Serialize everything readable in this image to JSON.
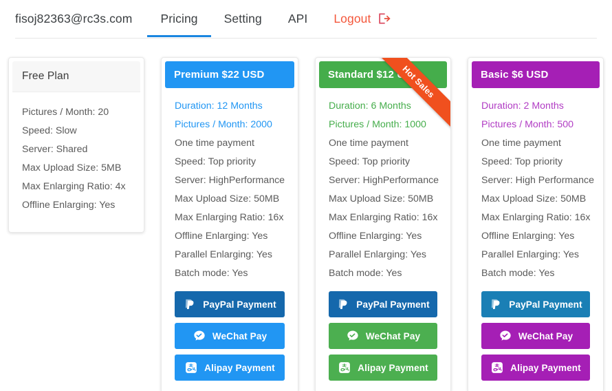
{
  "nav": {
    "brand": "fisoj82363@rc3s.com",
    "items": [
      {
        "label": "Pricing",
        "active": true
      },
      {
        "label": "Setting",
        "active": false
      },
      {
        "label": "API",
        "active": false
      }
    ],
    "logout": {
      "label": "Logout",
      "icon": "sign-out-icon",
      "color": "#f4573b"
    },
    "active_indicator_color": "#1a86e0"
  },
  "ribbon": {
    "text": "Hot Sales",
    "color": "#f0501e"
  },
  "plans": [
    {
      "id": "free",
      "title": "Free Plan",
      "accent": "#f7f7f7",
      "text_color": "#3b3b3b",
      "highlight_color": "#5a5a5a",
      "features": [
        "Pictures / Month: 20",
        "Speed: Slow",
        "Server: Shared",
        "Max Upload Size: 5MB",
        "Max Enlarging Ratio: 4x",
        "Offline Enlarging: Yes"
      ],
      "highlight_count": 0,
      "buttons": []
    },
    {
      "id": "premium",
      "title": "Premium $22 USD",
      "accent": "#2196f3",
      "text_color": "#ffffff",
      "highlight_color": "#2196f3",
      "features": [
        "Duration: 12 Months",
        "Pictures / Month: 2000",
        "One time payment",
        "Speed: Top priority",
        "Server: HighPerformance",
        "Max Upload Size: 50MB",
        "Max Enlarging Ratio: 16x",
        "Offline Enlarging: Yes",
        "Parallel Enlarging: Yes",
        "Batch mode: Yes"
      ],
      "highlight_count": 2,
      "buttons": [
        {
          "label": "PayPal Payment",
          "icon": "paypal-icon",
          "color": "#1568ac"
        },
        {
          "label": "WeChat Pay",
          "icon": "wechat-icon",
          "color": "#2196f3"
        },
        {
          "label": "Alipay Payment",
          "icon": "alipay-icon",
          "color": "#2196f3"
        }
      ]
    },
    {
      "id": "standard",
      "title": "Standard $12 USD",
      "accent": "#45ad4b",
      "text_color": "#ffffff",
      "highlight_color": "#45ad4b",
      "ribbon": true,
      "features": [
        "Duration: 6 Months",
        "Pictures / Month: 1000",
        "One time payment",
        "Speed: Top priority",
        "Server: HighPerformance",
        "Max Upload Size: 50MB",
        "Max Enlarging Ratio: 16x",
        "Offline Enlarging: Yes",
        "Parallel Enlarging: Yes",
        "Batch mode: Yes"
      ],
      "highlight_count": 2,
      "buttons": [
        {
          "label": "PayPal Payment",
          "icon": "paypal-icon",
          "color": "#1568ac"
        },
        {
          "label": "WeChat Pay",
          "icon": "wechat-icon",
          "color": "#4caf50"
        },
        {
          "label": "Alipay Payment",
          "icon": "alipay-icon",
          "color": "#4caf50"
        }
      ]
    },
    {
      "id": "basic",
      "title": "Basic $6 USD",
      "accent": "#a51fb5",
      "text_color": "#ffffff",
      "highlight_color": "#b13cc4",
      "features": [
        "Duration: 2 Months",
        "Pictures / Month: 500",
        "One time payment",
        "Speed: Top priority",
        "Server: High Performance",
        "Max Upload Size: 50MB",
        "Max Enlarging Ratio: 16x",
        "Offline Enlarging: Yes",
        "Parallel Enlarging: Yes",
        "Batch mode: Yes"
      ],
      "highlight_count": 2,
      "buttons": [
        {
          "label": "PayPal Payment",
          "icon": "paypal-icon",
          "color": "#1a7fb5"
        },
        {
          "label": "WeChat Pay",
          "icon": "wechat-icon",
          "color": "#a51fb5"
        },
        {
          "label": "Alipay Payment",
          "icon": "alipay-icon",
          "color": "#a51fb5"
        }
      ]
    }
  ]
}
